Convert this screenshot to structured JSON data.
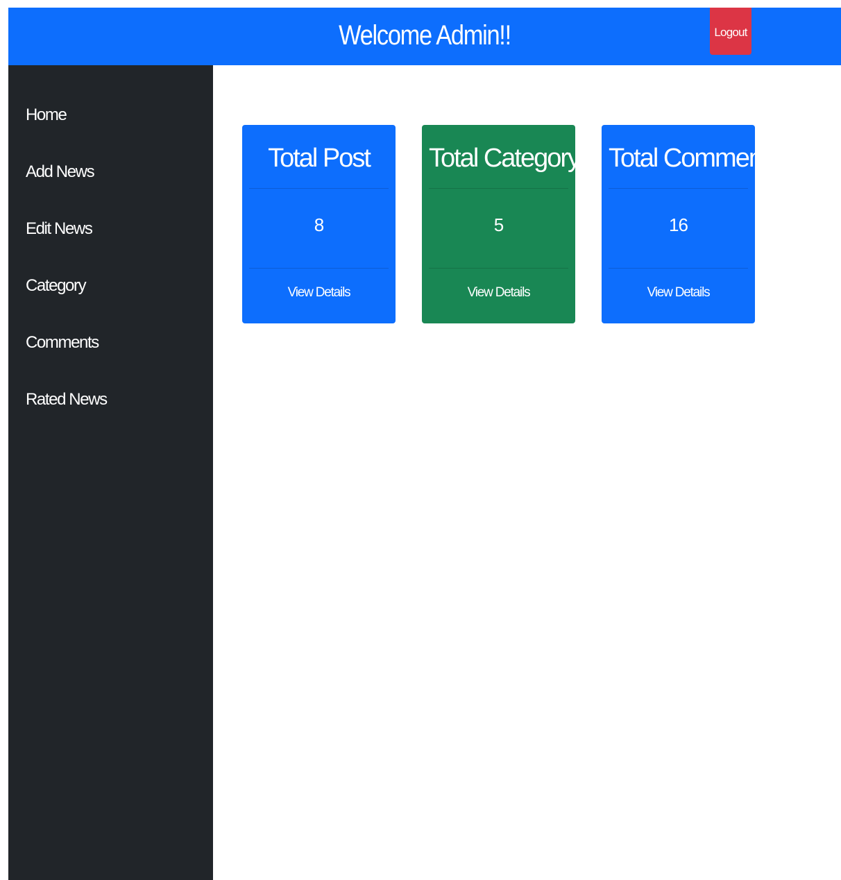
{
  "header": {
    "title": "Welcome Admin!!",
    "logout_label": "Logout"
  },
  "sidebar": {
    "items": [
      {
        "label": "Home"
      },
      {
        "label": "Add News"
      },
      {
        "label": "Edit News"
      },
      {
        "label": "Category"
      },
      {
        "label": "Comments"
      },
      {
        "label": "Rated News"
      }
    ]
  },
  "cards": [
    {
      "title": "Total Post",
      "value": "8",
      "link": "View Details",
      "color": "#0d6efd"
    },
    {
      "title": "Total Category",
      "value": "5",
      "link": "View Details",
      "color": "#198754"
    },
    {
      "title": "Total Comment",
      "value": "16",
      "link": "View Details",
      "color": "#0d6efd"
    }
  ],
  "colors": {
    "primary": "#0d6efd",
    "success": "#198754",
    "danger": "#dc3545",
    "sidebar_bg": "#212529"
  }
}
